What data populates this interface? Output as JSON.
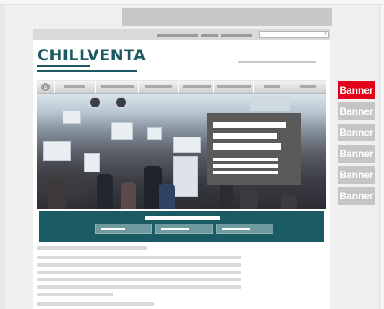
{
  "brand": {
    "logo_text": "CHILLVENTA",
    "teal": "#1b5c64",
    "accent_red": "#e3001b"
  },
  "header": {
    "search_icon": "⌕"
  },
  "nav": {
    "home_icon": "⌂"
  },
  "sidebar": {
    "banners": [
      {
        "label": "Banner",
        "color": "#e3001b"
      },
      {
        "label": "Banner",
        "color": "#c5c5c5"
      },
      {
        "label": "Banner",
        "color": "#c5c5c5"
      },
      {
        "label": "Banner",
        "color": "#c5c5c5"
      },
      {
        "label": "Banner",
        "color": "#c5c5c5"
      },
      {
        "label": "Banner",
        "color": "#c5c5c5"
      }
    ]
  }
}
